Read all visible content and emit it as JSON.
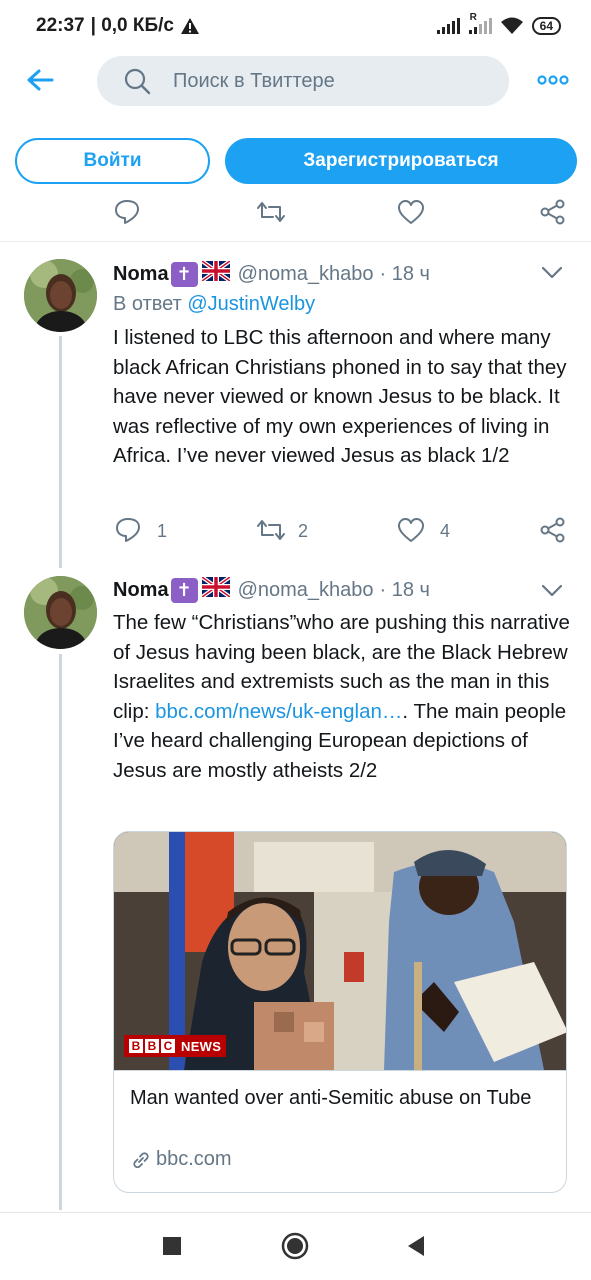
{
  "status_bar": {
    "time": "22:37",
    "net_speed": "| 0,0 КБ/с",
    "battery": "64",
    "roaming_indicator": "R",
    "icons": [
      "alert-icon",
      "signal-icon",
      "signal-roaming-icon",
      "wifi-icon",
      "battery-icon"
    ]
  },
  "header": {
    "search_placeholder": "Поиск в Твиттере",
    "icons": [
      "back-arrow-icon",
      "search-icon",
      "more-icon"
    ]
  },
  "auth": {
    "login_label": "Войти",
    "signup_label": "Зарегистрироваться"
  },
  "colors": {
    "accent": "#1da1f2",
    "link": "#1b95e0",
    "secondary_text": "#657786",
    "divider": "#e6ecf0"
  },
  "tweets": [
    {
      "name": "Noma",
      "name_emoji": "✝",
      "flag": "🇬🇧",
      "handle": "@noma_khabo",
      "time": "· 18 ч",
      "reply_prefix": "В ответ",
      "reply_to": "@JustinWelby",
      "text": "I listened to LBC this afternoon and where many black African Christians phoned in to say that they have never viewed or known Jesus to be black. It was reflective of my own experiences of living in Africa. I’ve never viewed Jesus as black 1/2",
      "replies": "1",
      "retweets": "2",
      "likes": "4"
    },
    {
      "name": "Noma",
      "name_emoji": "✝",
      "flag": "🇬🇧",
      "handle": "@noma_khabo",
      "time": "· 18 ч",
      "text_before_link": "The few “Christians”who are pushing this narrative of Jesus having been black, are the Black Hebrew Israelites and extremists such as the man in this clip: ",
      "link": "bbc.com/news/uk-englan…",
      "text_after_link": ". The main people I’ve heard challenging European depictions of Jesus are mostly atheists 2/2",
      "card": {
        "badge_letters": [
          "B",
          "B",
          "C"
        ],
        "badge_text": "NEWS",
        "title": "Man wanted over anti-Semitic abuse on Tube",
        "domain": "bbc.com"
      }
    }
  ],
  "nav": {
    "icons": [
      "recents-square-icon",
      "home-circle-icon",
      "back-triangle-icon"
    ]
  }
}
